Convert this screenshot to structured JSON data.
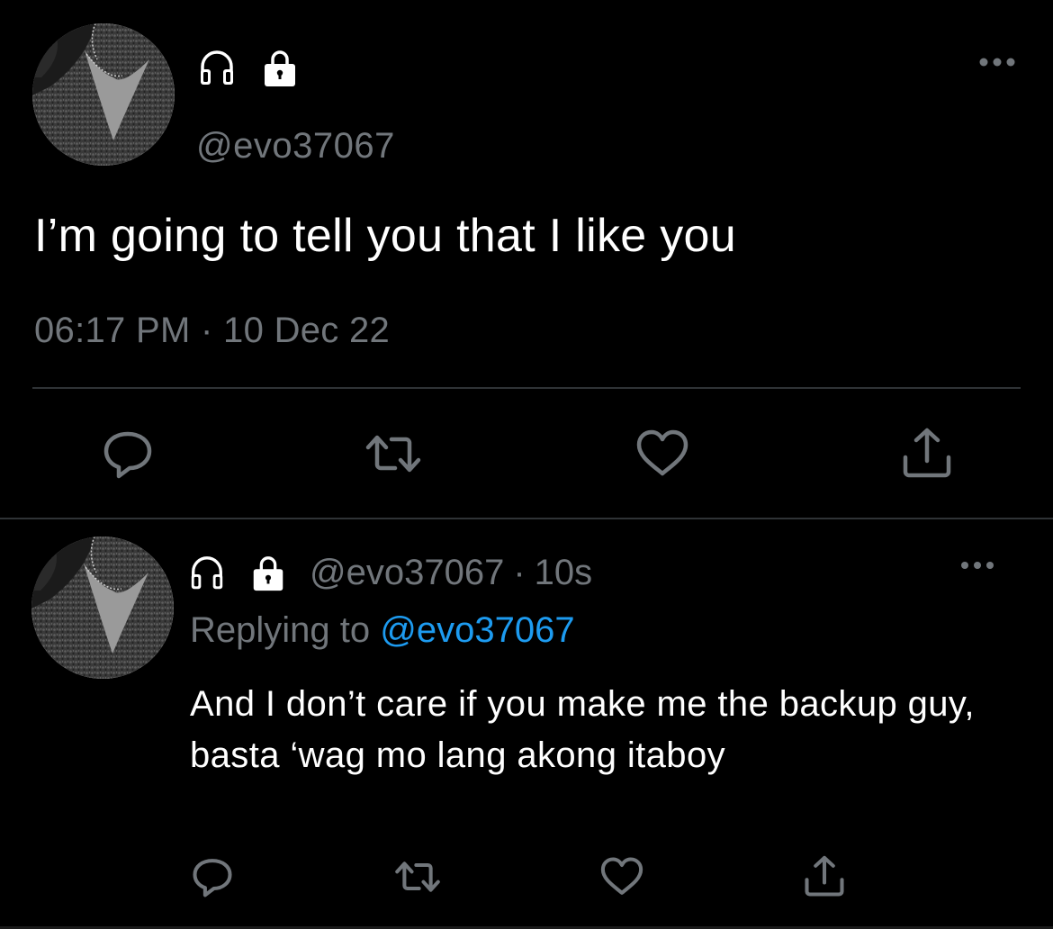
{
  "main_tweet": {
    "handle": "@evo37067",
    "text": "I’m going to tell you that I like you",
    "timestamp": "06:17 PM · 10 Dec 22",
    "badges": [
      "headphones-icon",
      "lock-icon"
    ],
    "actions": [
      "reply-icon",
      "retweet-icon",
      "like-icon",
      "share-icon"
    ]
  },
  "reply_tweet": {
    "handle": "@evo37067",
    "separator": "·",
    "age": "10s",
    "replying_prefix": "Replying to",
    "replying_to": "@evo37067",
    "text": "And I don’t care if you make me the backup guy, basta ‘wag mo lang akong itaboy",
    "badges": [
      "headphones-icon",
      "lock-icon"
    ],
    "actions": [
      "reply-icon",
      "retweet-icon",
      "like-icon",
      "share-icon"
    ]
  },
  "colors": {
    "background": "#000000",
    "text_primary": "#ffffff",
    "text_secondary": "#71767b",
    "link": "#1d9bf0",
    "divider": "#2f3336"
  }
}
